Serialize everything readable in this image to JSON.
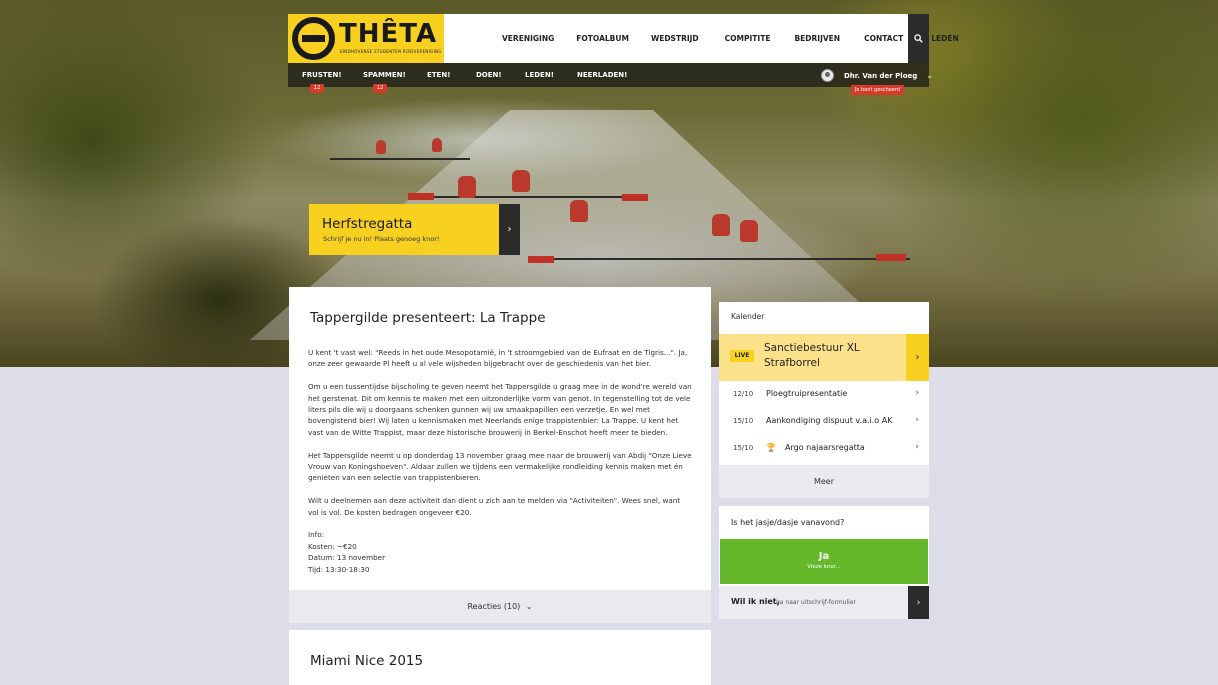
{
  "logo": {
    "title": "THÊTA",
    "subtitle": "EINDHOVENSE STUDENTEN ROEIVERENIGING"
  },
  "main_nav": [
    "VERENIGING",
    "FOTOALBUM",
    "WEDSTRIJD",
    "COMPITITE",
    "BEDRIJVEN",
    "CONTACT",
    "LEDEN"
  ],
  "sub_nav": [
    {
      "label": "FRUSTEN!",
      "badge": "12"
    },
    {
      "label": "SPAMMEN!",
      "badge": "12"
    },
    {
      "label": "ETEN!"
    },
    {
      "label": "DOEN!"
    },
    {
      "label": "LEDEN!"
    },
    {
      "label": "NEERLADEN!"
    }
  ],
  "user": {
    "name": "Dhr. Van der Ploeg",
    "status": "Je bent gescheerd"
  },
  "promo": {
    "title": "Herfstregatta",
    "subtitle": "Schrijf je nu in! Plaats genoeg knor!"
  },
  "article": {
    "title": "Tappergilde presenteert: La Trappe",
    "paragraphs": [
      "U kent 't vast wel: \"Reeds in het oude Mesopotamië, in 't stroomgebied van de Eufraat en de Tigris...\". Ja, onze zeer gewaarde Pl heeft u al vele wijsheden bijgebracht over de geschiedenis van het bier.",
      "Om u een tussentijdse bijscholing te geven neemt het Tappersgilde u graag mee in de wond're wereld van het gerstenat. Dit om kennis te maken met een uitzonderlijke vorm van genot. In tegenstelling tot de vele liters pils die wij u doorgaans schenken gunnen wij uw smaakpapillen een verzetje. En wel met bovengistend bier! Wij laten u kennismaken met Neerlands enige trappistenbier: La Trappe. U kent het vast van de Witte Trappist, maar deze historische brouwerij in Berkel-Enschot heeft meer te bieden.",
      "Het Tappersgilde neemt u op donderdag 13 november graag mee naar de brouwerij van Abdij \"Onze Lieve Vrouw van Koningshoeven\". Aldaar zullen we tijdens een vermakelijke rondleiding kennis maken met én genieten van een selectie van trappistenbieren.",
      "Wilt u deelnemen aan deze activiteit dan dient u zich aan te melden via \"Activiteiten\". Wees snel, want vol is vol. De kosten bedragen ongeveer €20."
    ],
    "info": [
      "Info:",
      "Kosten: ~€20",
      "Datum: 13 november",
      "Tijd: 13:30-18:30"
    ],
    "reactions": "Reacties (10)"
  },
  "article2": {
    "title": "Miami Nice 2015"
  },
  "calendar": {
    "heading": "Kalender",
    "live": {
      "tag": "LIVE",
      "title": "Sanctiebestuur XL Strafborrel"
    },
    "events": [
      {
        "date": "12/10",
        "name": "Ploegtruipresentatie"
      },
      {
        "date": "15/10",
        "name": "Aankondiging dispuut v.a.i.o AK"
      },
      {
        "date": "15/10",
        "name": "Argo najaarsregatta"
      }
    ],
    "more": "Meer"
  },
  "poll": {
    "question": "Is het jasje/dasje vanavond?",
    "yes_label": "Ja",
    "yes_sub": "Vieze knor...",
    "no_label": "Wil ik niet,",
    "no_sub": "ga naar uitschrijf-formulier"
  },
  "colors": {
    "accent": "#f7d020",
    "dark": "#2b2b2b",
    "green": "#64b82a",
    "badge": "#d63a2a"
  }
}
